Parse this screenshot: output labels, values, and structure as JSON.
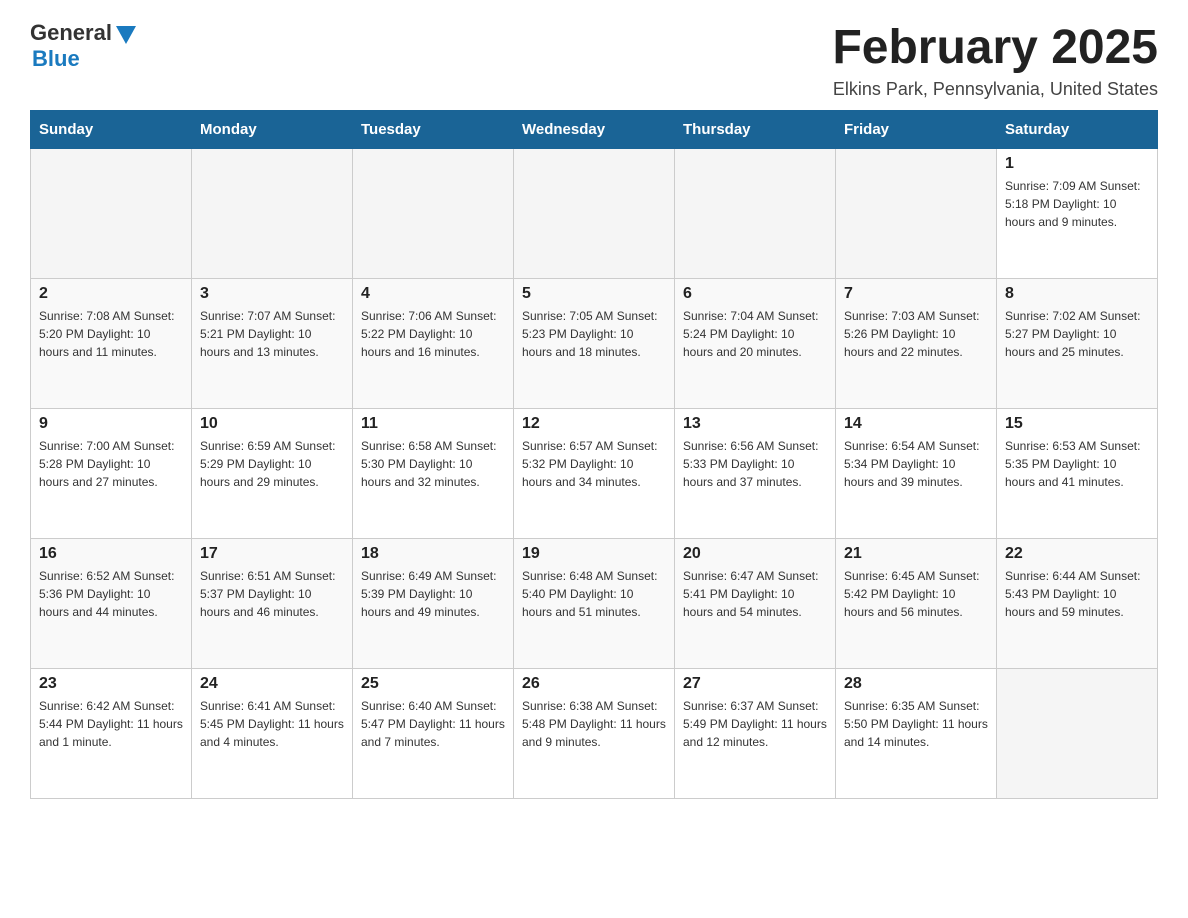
{
  "header": {
    "logo_general": "General",
    "logo_blue": "Blue",
    "month_title": "February 2025",
    "location": "Elkins Park, Pennsylvania, United States"
  },
  "days_of_week": [
    "Sunday",
    "Monday",
    "Tuesday",
    "Wednesday",
    "Thursday",
    "Friday",
    "Saturday"
  ],
  "weeks": [
    [
      {
        "day": "",
        "info": ""
      },
      {
        "day": "",
        "info": ""
      },
      {
        "day": "",
        "info": ""
      },
      {
        "day": "",
        "info": ""
      },
      {
        "day": "",
        "info": ""
      },
      {
        "day": "",
        "info": ""
      },
      {
        "day": "1",
        "info": "Sunrise: 7:09 AM\nSunset: 5:18 PM\nDaylight: 10 hours and 9 minutes."
      }
    ],
    [
      {
        "day": "2",
        "info": "Sunrise: 7:08 AM\nSunset: 5:20 PM\nDaylight: 10 hours and 11 minutes."
      },
      {
        "day": "3",
        "info": "Sunrise: 7:07 AM\nSunset: 5:21 PM\nDaylight: 10 hours and 13 minutes."
      },
      {
        "day": "4",
        "info": "Sunrise: 7:06 AM\nSunset: 5:22 PM\nDaylight: 10 hours and 16 minutes."
      },
      {
        "day": "5",
        "info": "Sunrise: 7:05 AM\nSunset: 5:23 PM\nDaylight: 10 hours and 18 minutes."
      },
      {
        "day": "6",
        "info": "Sunrise: 7:04 AM\nSunset: 5:24 PM\nDaylight: 10 hours and 20 minutes."
      },
      {
        "day": "7",
        "info": "Sunrise: 7:03 AM\nSunset: 5:26 PM\nDaylight: 10 hours and 22 minutes."
      },
      {
        "day": "8",
        "info": "Sunrise: 7:02 AM\nSunset: 5:27 PM\nDaylight: 10 hours and 25 minutes."
      }
    ],
    [
      {
        "day": "9",
        "info": "Sunrise: 7:00 AM\nSunset: 5:28 PM\nDaylight: 10 hours and 27 minutes."
      },
      {
        "day": "10",
        "info": "Sunrise: 6:59 AM\nSunset: 5:29 PM\nDaylight: 10 hours and 29 minutes."
      },
      {
        "day": "11",
        "info": "Sunrise: 6:58 AM\nSunset: 5:30 PM\nDaylight: 10 hours and 32 minutes."
      },
      {
        "day": "12",
        "info": "Sunrise: 6:57 AM\nSunset: 5:32 PM\nDaylight: 10 hours and 34 minutes."
      },
      {
        "day": "13",
        "info": "Sunrise: 6:56 AM\nSunset: 5:33 PM\nDaylight: 10 hours and 37 minutes."
      },
      {
        "day": "14",
        "info": "Sunrise: 6:54 AM\nSunset: 5:34 PM\nDaylight: 10 hours and 39 minutes."
      },
      {
        "day": "15",
        "info": "Sunrise: 6:53 AM\nSunset: 5:35 PM\nDaylight: 10 hours and 41 minutes."
      }
    ],
    [
      {
        "day": "16",
        "info": "Sunrise: 6:52 AM\nSunset: 5:36 PM\nDaylight: 10 hours and 44 minutes."
      },
      {
        "day": "17",
        "info": "Sunrise: 6:51 AM\nSunset: 5:37 PM\nDaylight: 10 hours and 46 minutes."
      },
      {
        "day": "18",
        "info": "Sunrise: 6:49 AM\nSunset: 5:39 PM\nDaylight: 10 hours and 49 minutes."
      },
      {
        "day": "19",
        "info": "Sunrise: 6:48 AM\nSunset: 5:40 PM\nDaylight: 10 hours and 51 minutes."
      },
      {
        "day": "20",
        "info": "Sunrise: 6:47 AM\nSunset: 5:41 PM\nDaylight: 10 hours and 54 minutes."
      },
      {
        "day": "21",
        "info": "Sunrise: 6:45 AM\nSunset: 5:42 PM\nDaylight: 10 hours and 56 minutes."
      },
      {
        "day": "22",
        "info": "Sunrise: 6:44 AM\nSunset: 5:43 PM\nDaylight: 10 hours and 59 minutes."
      }
    ],
    [
      {
        "day": "23",
        "info": "Sunrise: 6:42 AM\nSunset: 5:44 PM\nDaylight: 11 hours and 1 minute."
      },
      {
        "day": "24",
        "info": "Sunrise: 6:41 AM\nSunset: 5:45 PM\nDaylight: 11 hours and 4 minutes."
      },
      {
        "day": "25",
        "info": "Sunrise: 6:40 AM\nSunset: 5:47 PM\nDaylight: 11 hours and 7 minutes."
      },
      {
        "day": "26",
        "info": "Sunrise: 6:38 AM\nSunset: 5:48 PM\nDaylight: 11 hours and 9 minutes."
      },
      {
        "day": "27",
        "info": "Sunrise: 6:37 AM\nSunset: 5:49 PM\nDaylight: 11 hours and 12 minutes."
      },
      {
        "day": "28",
        "info": "Sunrise: 6:35 AM\nSunset: 5:50 PM\nDaylight: 11 hours and 14 minutes."
      },
      {
        "day": "",
        "info": ""
      }
    ]
  ]
}
